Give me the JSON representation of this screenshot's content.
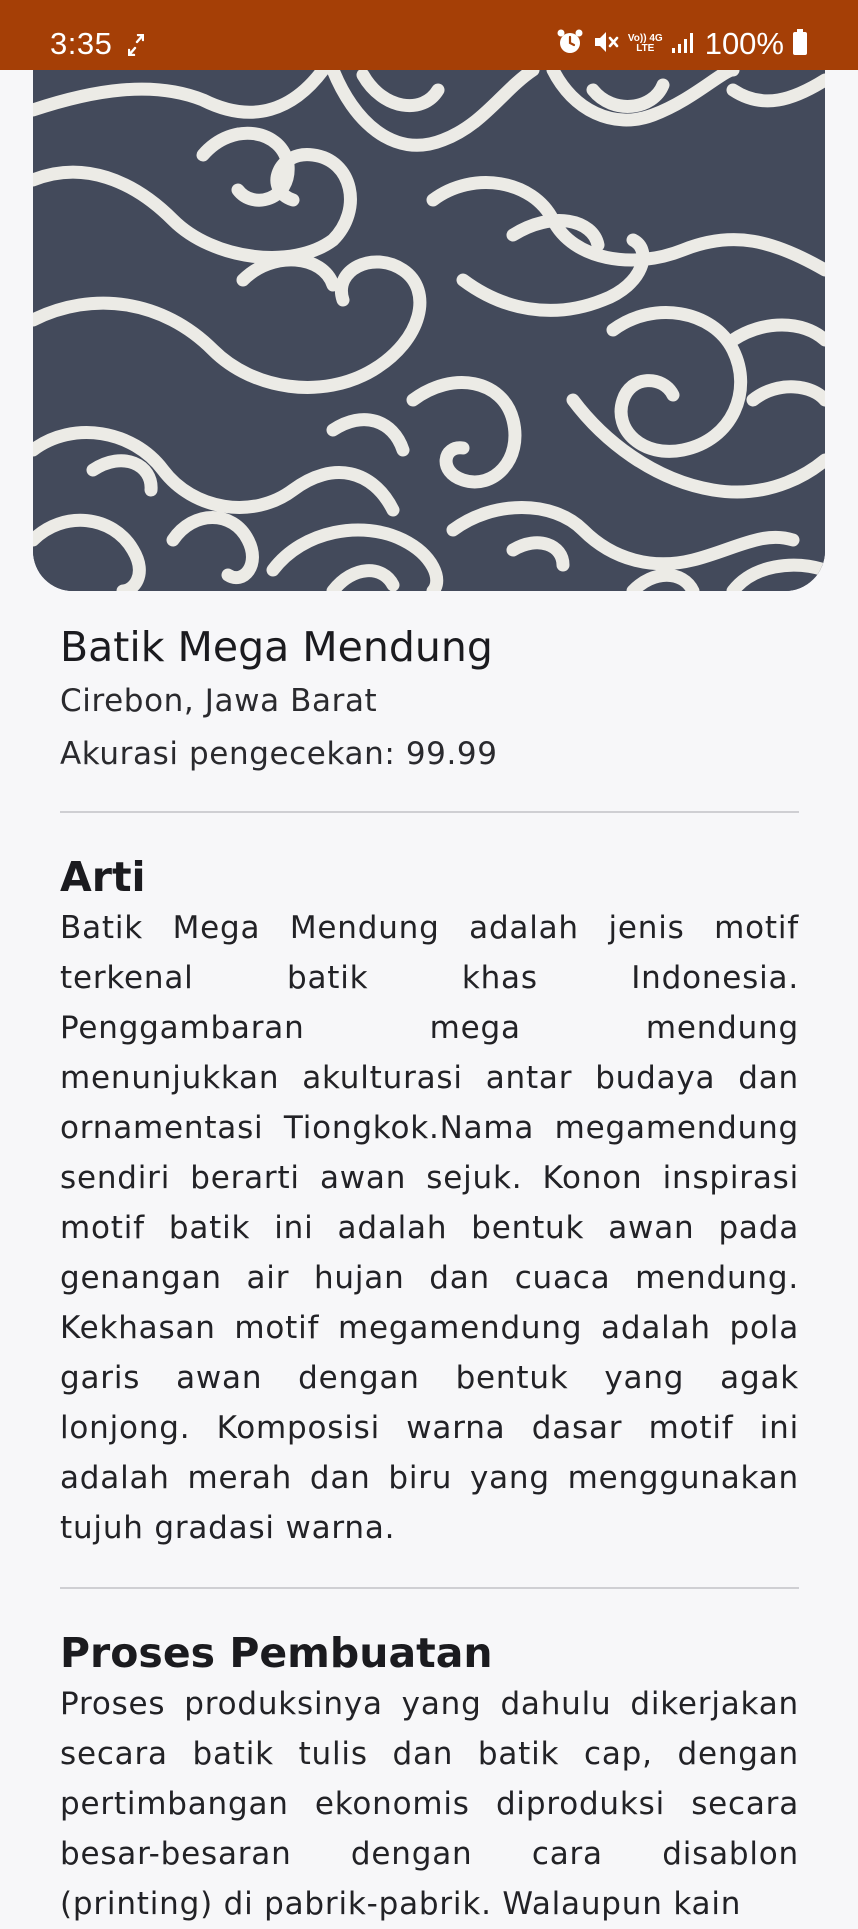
{
  "status_bar": {
    "time": "3:35",
    "battery": "100%",
    "net_top": "Vo)) 4G",
    "net_bottom": "LTE"
  },
  "hero": {
    "image_icon": "mega-mendung-batik-image",
    "colors": {
      "background": "#434a5b",
      "pattern": "#ecebe6"
    }
  },
  "detail": {
    "name": "Batik Mega Mendung",
    "origin": "Cirebon, Jawa Barat",
    "accuracy": "Akurasi pengecekan: 99.99"
  },
  "sections": {
    "meaning_title": "Arti",
    "meaning_body": "Batik Mega Mendung adalah jenis motif terkenal batik khas Indonesia. Penggambaran mega mendung menunjukkan akulturasi antar budaya dan ornamentasi Tiongkok.Nama megamendung sendiri berarti awan sejuk. Konon inspirasi motif batik ini adalah bentuk awan pada genangan air hujan dan cuaca mendung. Kekhasan motif megamendung adalah pola garis awan dengan bentuk yang agak lonjong. Komposisi warna dasar motif ini adalah merah dan biru yang menggunakan tujuh gradasi warna.",
    "process_title": "Proses Pembuatan",
    "process_body": "Proses produksinya yang dahulu dikerjakan secara batik tulis dan batik cap, dengan pertimbangan ekonomis diproduksi secara besar-besaran dengan cara disablon (printing) di pabrik-pabrik. Walaupun kain"
  },
  "colors": {
    "status_bar": "#a53f06",
    "page_background": "#f7f7f9",
    "divider": "#cfcfd3"
  }
}
